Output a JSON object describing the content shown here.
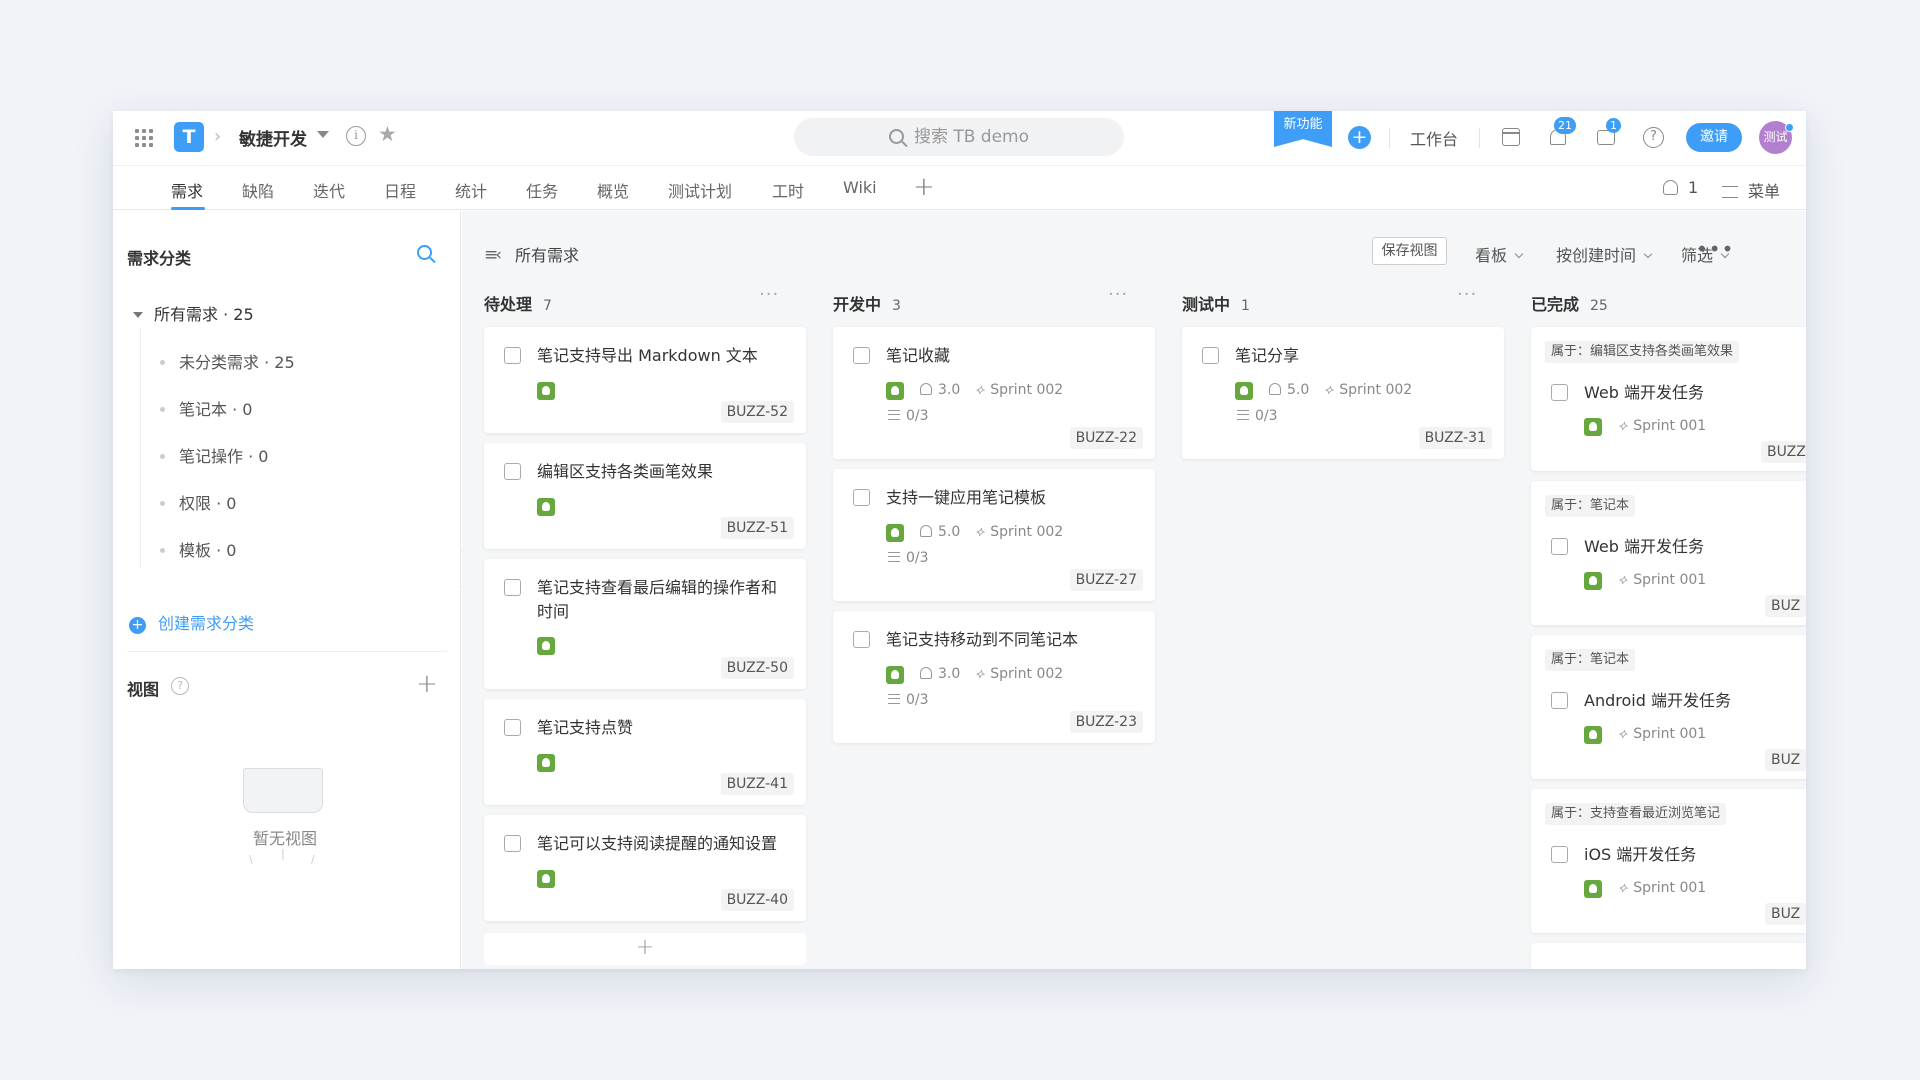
{
  "topbar": {
    "project_title": "敏捷开发",
    "search_placeholder": "搜索 TB demo",
    "new_feature": "新功能",
    "workbench": "工作台",
    "notifications_count": "21",
    "messages_count": "1",
    "invite": "邀请",
    "avatar_text": "测试"
  },
  "tabs": [
    "需求",
    "缺陷",
    "迭代",
    "日程",
    "统计",
    "任务",
    "概览",
    "测试计划",
    "工时",
    "Wiki"
  ],
  "active_tab": "需求",
  "tabbar_right": {
    "members": "1",
    "menu": "菜单"
  },
  "sidebar": {
    "title": "需求分类",
    "root": "所有需求 · 25",
    "items": [
      "未分类需求 · 25",
      "笔记本 · 0",
      "笔记操作 · 0",
      "权限 · 0",
      "模板 · 0"
    ],
    "create": "创建需求分类",
    "view_title": "视图",
    "empty_text": "暂无视图"
  },
  "toolbar": {
    "list_title": "所有需求",
    "save_view": "保存视图",
    "board": "看板",
    "sort": "按创建时间",
    "filter": "筛选"
  },
  "columns": [
    {
      "name": "待处理",
      "count": "7",
      "cards": [
        {
          "title": "笔记支持导出 Markdown 文本",
          "code": "BUZZ-52"
        },
        {
          "title": "编辑区支持各类画笔效果",
          "code": "BUZZ-51"
        },
        {
          "title": "笔记支持查看最后编辑的操作者和时间",
          "code": "BUZZ-50"
        },
        {
          "title": "笔记支持点赞",
          "code": "BUZZ-41"
        },
        {
          "title": "笔记可以支持阅读提醒的通知设置",
          "code": "BUZZ-40"
        }
      ]
    },
    {
      "name": "开发中",
      "count": "3",
      "cards": [
        {
          "title": "笔记收藏",
          "points": "3.0",
          "sprint": "Sprint 002",
          "subtasks": "0/3",
          "code": "BUZZ-22"
        },
        {
          "title": "支持一键应用笔记模板",
          "points": "5.0",
          "sprint": "Sprint 002",
          "subtasks": "0/3",
          "code": "BUZZ-27"
        },
        {
          "title": "笔记支持移动到不同笔记本",
          "points": "3.0",
          "sprint": "Sprint 002",
          "subtasks": "0/3",
          "code": "BUZZ-23"
        }
      ]
    },
    {
      "name": "测试中",
      "count": "1",
      "cards": [
        {
          "title": "笔记分享",
          "points": "5.0",
          "sprint": "Sprint 002",
          "subtasks": "0/3",
          "code": "BUZZ-31"
        }
      ]
    },
    {
      "name": "已完成",
      "count": "25",
      "cards": [
        {
          "parent": "属于：编辑区支持各类画笔效果",
          "title": "Web 端开发任务",
          "sprint": "Sprint 001",
          "code": "BUZZ"
        },
        {
          "parent": "属于：笔记本",
          "title": "Web 端开发任务",
          "sprint": "Sprint 001",
          "code": "BUZ"
        },
        {
          "parent": "属于：笔记本",
          "title": "Android 端开发任务",
          "sprint": "Sprint 001",
          "code": "BUZ"
        },
        {
          "parent": "属于：支持查看最近浏览笔记",
          "title": "iOS 端开发任务",
          "sprint": "Sprint 001",
          "code": "BUZ"
        }
      ]
    }
  ],
  "colors": {
    "accent": "#3e9df6",
    "requirement_green": "#66a83d",
    "avatar_purple": "#b37fd1"
  }
}
